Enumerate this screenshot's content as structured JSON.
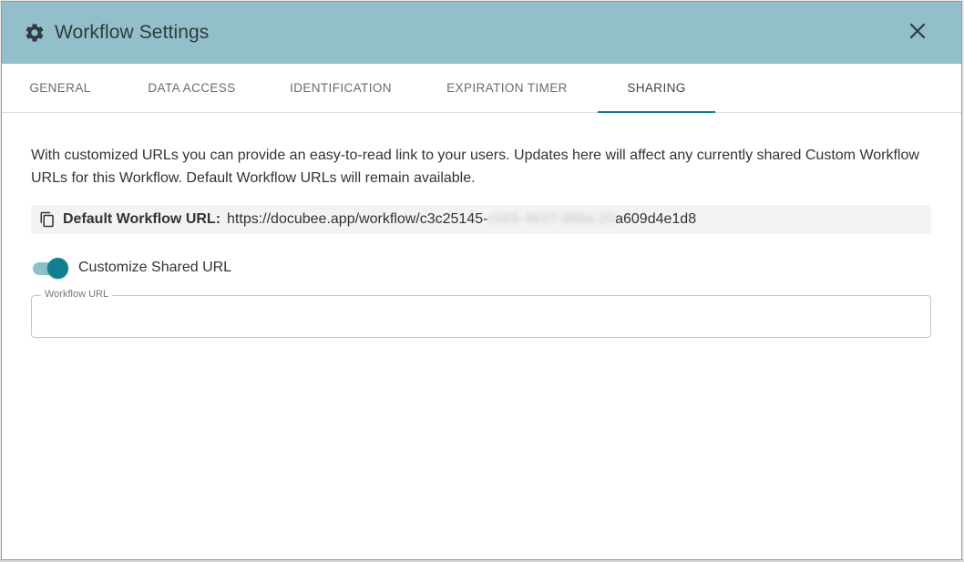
{
  "dialog": {
    "title": "Workflow Settings",
    "icon": "gear-icon",
    "close_icon": "close-icon"
  },
  "tabs": [
    {
      "label": "GENERAL",
      "active": false
    },
    {
      "label": "DATA ACCESS",
      "active": false
    },
    {
      "label": "IDENTIFICATION",
      "active": false
    },
    {
      "label": "EXPIRATION TIMER",
      "active": false
    },
    {
      "label": "SHARING",
      "active": true
    }
  ],
  "sharing": {
    "description": "With customized URLs you can provide an easy-to-read link to your users. Updates here will affect any currently shared Custom Workflow URLs for this Workflow. Default Workflow URLs will remain available.",
    "default_url_label": "Default Workflow URL:",
    "default_url_prefix": "https://docubee.app/workflow/c3c25145-",
    "default_url_redacted": "c565-4637-989a-20",
    "default_url_suffix": "a609d4e1d8",
    "customize_label": "Customize Shared URL",
    "customize_enabled": true,
    "workflow_url_label": "Workflow URL",
    "workflow_url_value": ""
  },
  "colors": {
    "header_bg": "#92bfc9",
    "accent": "#127f91",
    "toggle_track": "#8cc0cb"
  }
}
